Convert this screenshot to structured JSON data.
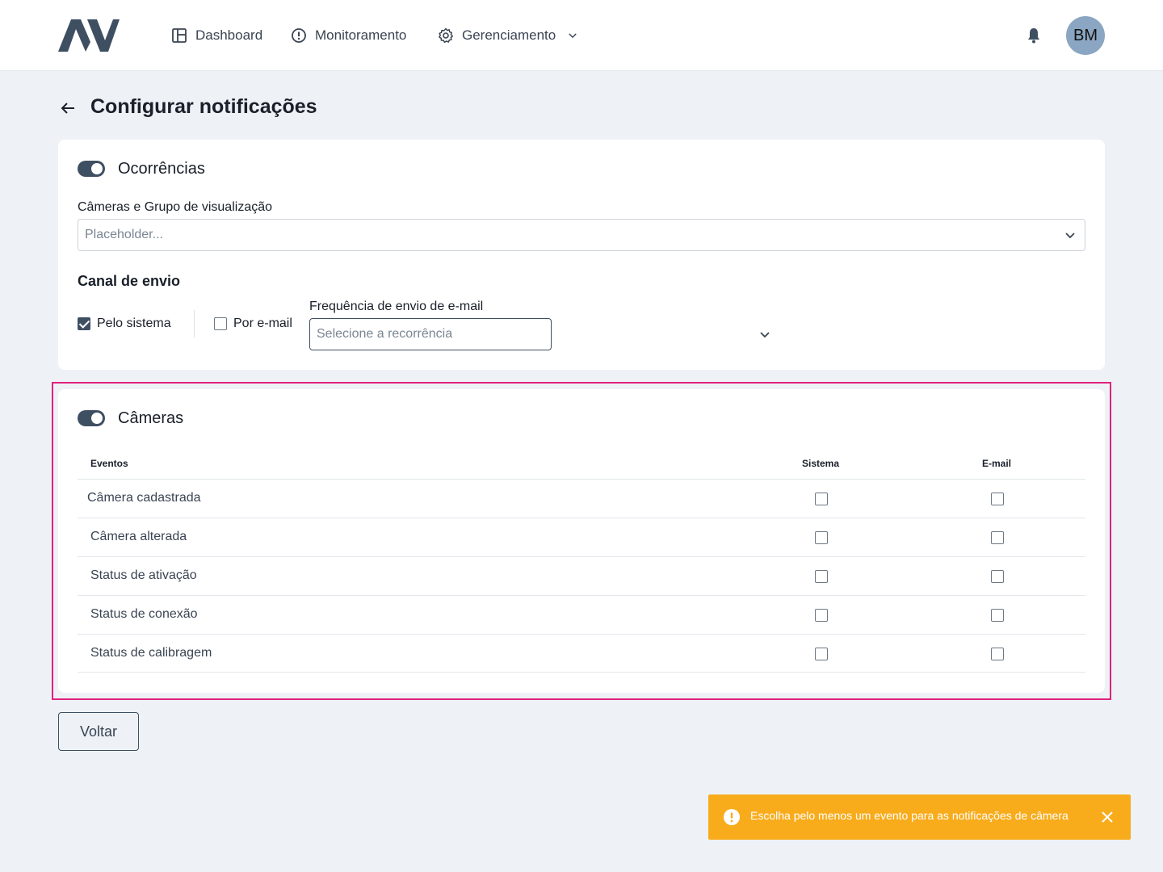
{
  "nav": {
    "logo": "AV",
    "items": [
      {
        "label": "Dashboard",
        "icon": "layout-icon"
      },
      {
        "label": "Monitoramento",
        "icon": "alert-circle-icon"
      },
      {
        "label": "Gerenciamento",
        "icon": "gear-icon"
      }
    ],
    "avatar_initials": "BM"
  },
  "page": {
    "title": "Configurar notificações"
  },
  "occurrences": {
    "title": "Ocorrências",
    "enabled": true,
    "cameras_label": "Câmeras e Grupo de visualização",
    "cameras_placeholder": "Placeholder...",
    "channel_title": "Canal de envio",
    "channels": [
      {
        "label": "Pelo sistema",
        "checked": true
      },
      {
        "label": "Por e-mail",
        "checked": false
      }
    ],
    "frequency_label": "Frequência de envio de e-mail",
    "frequency_placeholder": "Selecione a recorrência"
  },
  "cameras": {
    "title": "Câmeras",
    "enabled": true,
    "columns": [
      "Eventos",
      "Sistema",
      "E-mail"
    ],
    "rows": [
      {
        "label": "Câmera cadastrada",
        "system": false,
        "email": false
      },
      {
        "label": "Câmera alterada",
        "system": false,
        "email": false
      },
      {
        "label": "Status de ativação",
        "system": false,
        "email": false
      },
      {
        "label": "Status de conexão",
        "system": false,
        "email": false
      },
      {
        "label": "Status de calibragem",
        "system": false,
        "email": false
      }
    ]
  },
  "footer": {
    "back_label": "Voltar"
  },
  "toast": {
    "message": "Escolha pelo menos um evento para as notificações de câmera",
    "color": "#f8ac1c"
  },
  "colors": {
    "primary": "#3f4f62",
    "highlight": "#e0217e",
    "background": "#eef2f6"
  }
}
